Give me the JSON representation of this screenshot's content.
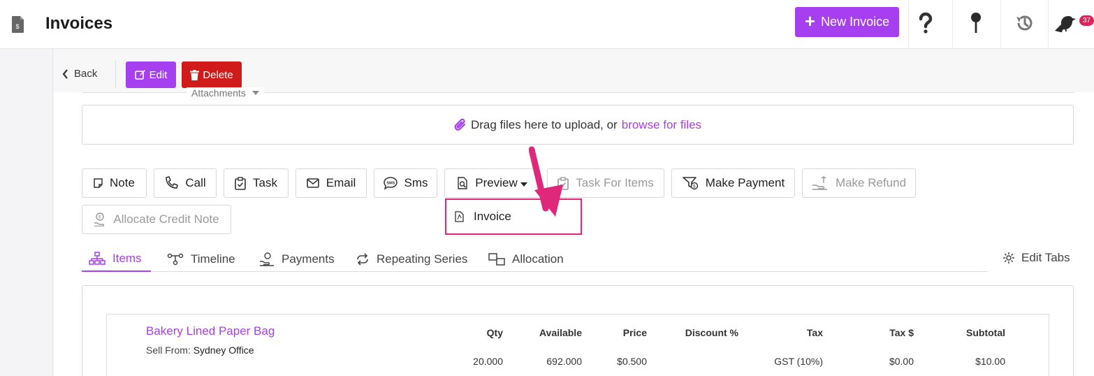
{
  "header": {
    "title": "Invoices",
    "new_invoice_label": "New Invoice",
    "notification_count": "37"
  },
  "toolbar": {
    "back_label": "Back",
    "edit_label": "Edit",
    "delete_label": "Delete"
  },
  "attachments": {
    "label": "Attachments",
    "drop_text": "Drag files here to upload, or",
    "browse_link": "browse for files"
  },
  "actions": [
    {
      "label": "Note",
      "icon": "note-icon",
      "enabled": true
    },
    {
      "label": "Call",
      "icon": "phone-icon",
      "enabled": true
    },
    {
      "label": "Task",
      "icon": "clipboard-check-icon",
      "enabled": true
    },
    {
      "label": "Email",
      "icon": "envelope-icon",
      "enabled": true
    },
    {
      "label": "Sms",
      "icon": "sms-bubble-icon",
      "enabled": true
    },
    {
      "label": "Preview",
      "icon": "file-search-icon",
      "enabled": true
    },
    {
      "label": "Task For Items",
      "icon": "clipboard-check-icon",
      "enabled": false
    },
    {
      "label": "Make Payment",
      "icon": "payment-icon",
      "enabled": true
    },
    {
      "label": "Make Refund",
      "icon": "refund-icon",
      "enabled": false
    },
    {
      "label": "Allocate Credit Note",
      "icon": "credit-note-icon",
      "enabled": false
    }
  ],
  "preview_menu": {
    "items": [
      {
        "label": "Invoice",
        "icon": "pdf-file-icon"
      }
    ]
  },
  "tabs": [
    {
      "label": "Items",
      "icon": "sitemap-icon",
      "active": true
    },
    {
      "label": "Timeline",
      "icon": "timeline-icon",
      "active": false
    },
    {
      "label": "Payments",
      "icon": "hand-coin-icon",
      "active": false
    },
    {
      "label": "Repeating Series",
      "icon": "repeat-icon",
      "active": false
    },
    {
      "label": "Allocation",
      "icon": "allocation-icon",
      "active": false
    }
  ],
  "edit_tabs_label": "Edit Tabs",
  "items_table": {
    "product_name": "Bakery Lined Paper Bag",
    "sell_from_label": "Sell From:",
    "sell_from_value": "Sydney Office",
    "columns": [
      "Qty",
      "Available",
      "Price",
      "Discount %",
      "Tax",
      "Tax $",
      "Subtotal"
    ],
    "row": [
      "20.000",
      "692.000",
      "$0.500",
      "",
      "GST (10%)",
      "$0.00",
      "$10.00"
    ]
  },
  "colors": {
    "accent": "#a63ff0",
    "danger": "#d11a1a",
    "annotation": "#e0287a"
  }
}
